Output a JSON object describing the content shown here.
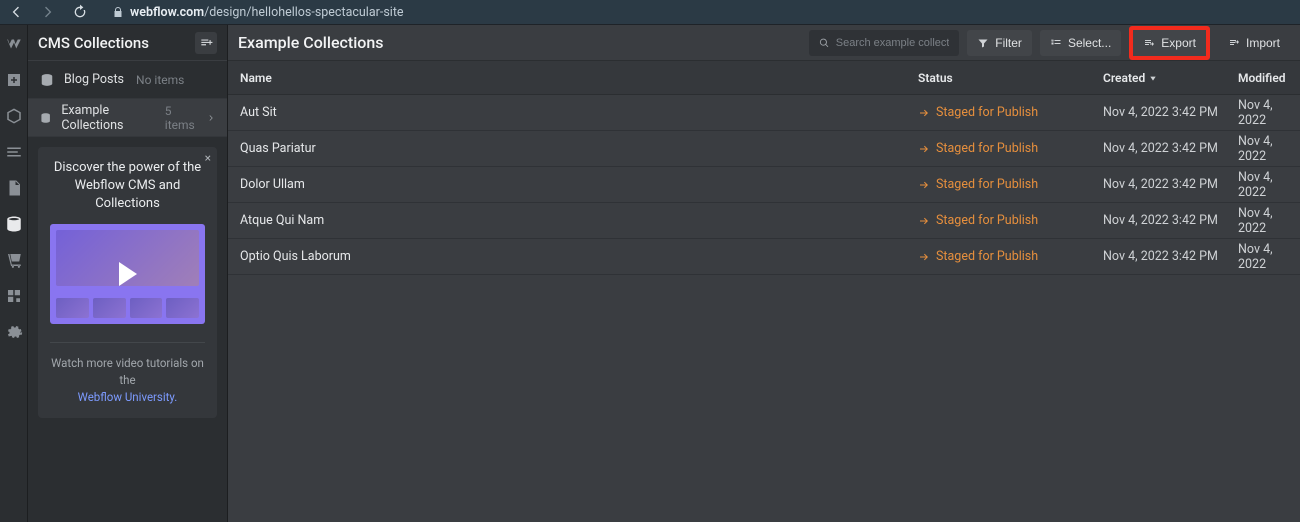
{
  "browser": {
    "url_domain": "webflow.com",
    "url_path": "/design/hellohellos-spectacular-site"
  },
  "left_panel": {
    "title": "CMS Collections",
    "collections": [
      {
        "name": "Blog Posts",
        "meta": "No items",
        "active": false
      },
      {
        "name": "Example Collections",
        "meta": "5 items",
        "active": true
      }
    ],
    "promo": {
      "title": "Discover the power of the Webflow CMS and Collections",
      "close": "×",
      "footer_text": "Watch more video tutorials on the",
      "footer_link": "Webflow University."
    }
  },
  "topbar": {
    "title": "Example Collections",
    "search_placeholder": "Search example collections",
    "filter": "Filter",
    "select": "Select...",
    "export": "Export",
    "import": "Import"
  },
  "columns": {
    "name": "Name",
    "status": "Status",
    "created": "Created",
    "modified": "Modified"
  },
  "rows": [
    {
      "name": "Aut Sit",
      "status": "Staged for Publish",
      "created": "Nov 4, 2022 3:42 PM",
      "modified": "Nov 4, 2022"
    },
    {
      "name": "Quas Pariatur",
      "status": "Staged for Publish",
      "created": "Nov 4, 2022 3:42 PM",
      "modified": "Nov 4, 2022"
    },
    {
      "name": "Dolor Ullam",
      "status": "Staged for Publish",
      "created": "Nov 4, 2022 3:42 PM",
      "modified": "Nov 4, 2022"
    },
    {
      "name": "Atque Qui Nam",
      "status": "Staged for Publish",
      "created": "Nov 4, 2022 3:42 PM",
      "modified": "Nov 4, 2022"
    },
    {
      "name": "Optio Quis Laborum",
      "status": "Staged for Publish",
      "created": "Nov 4, 2022 3:42 PM",
      "modified": "Nov 4, 2022"
    }
  ]
}
